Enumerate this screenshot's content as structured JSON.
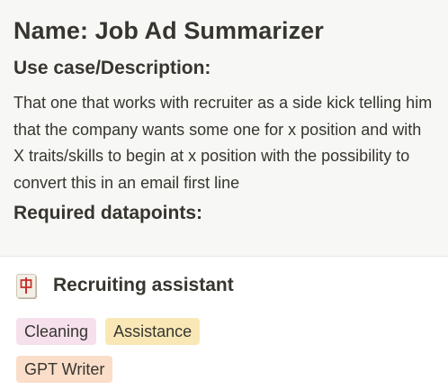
{
  "preview": {
    "title": "Name: Job Ad Summarizer",
    "section_heading": "Use case/Description:",
    "description": "That one that works with recruiter as a side kick telling him that the company wants some one for x position and with X traits/skills to begin at x position with the possibility to convert this in an email first line",
    "next_heading": "Required datapoints:"
  },
  "card": {
    "icon": "mahjong-red-dragon-icon",
    "title": "Recruiting assistant",
    "tags": [
      {
        "label": "Cleaning",
        "color": "#f5e0ec"
      },
      {
        "label": "Assistance",
        "color": "#f9e8b6"
      },
      {
        "label": "GPT Writer",
        "color": "#fadec9"
      }
    ]
  }
}
